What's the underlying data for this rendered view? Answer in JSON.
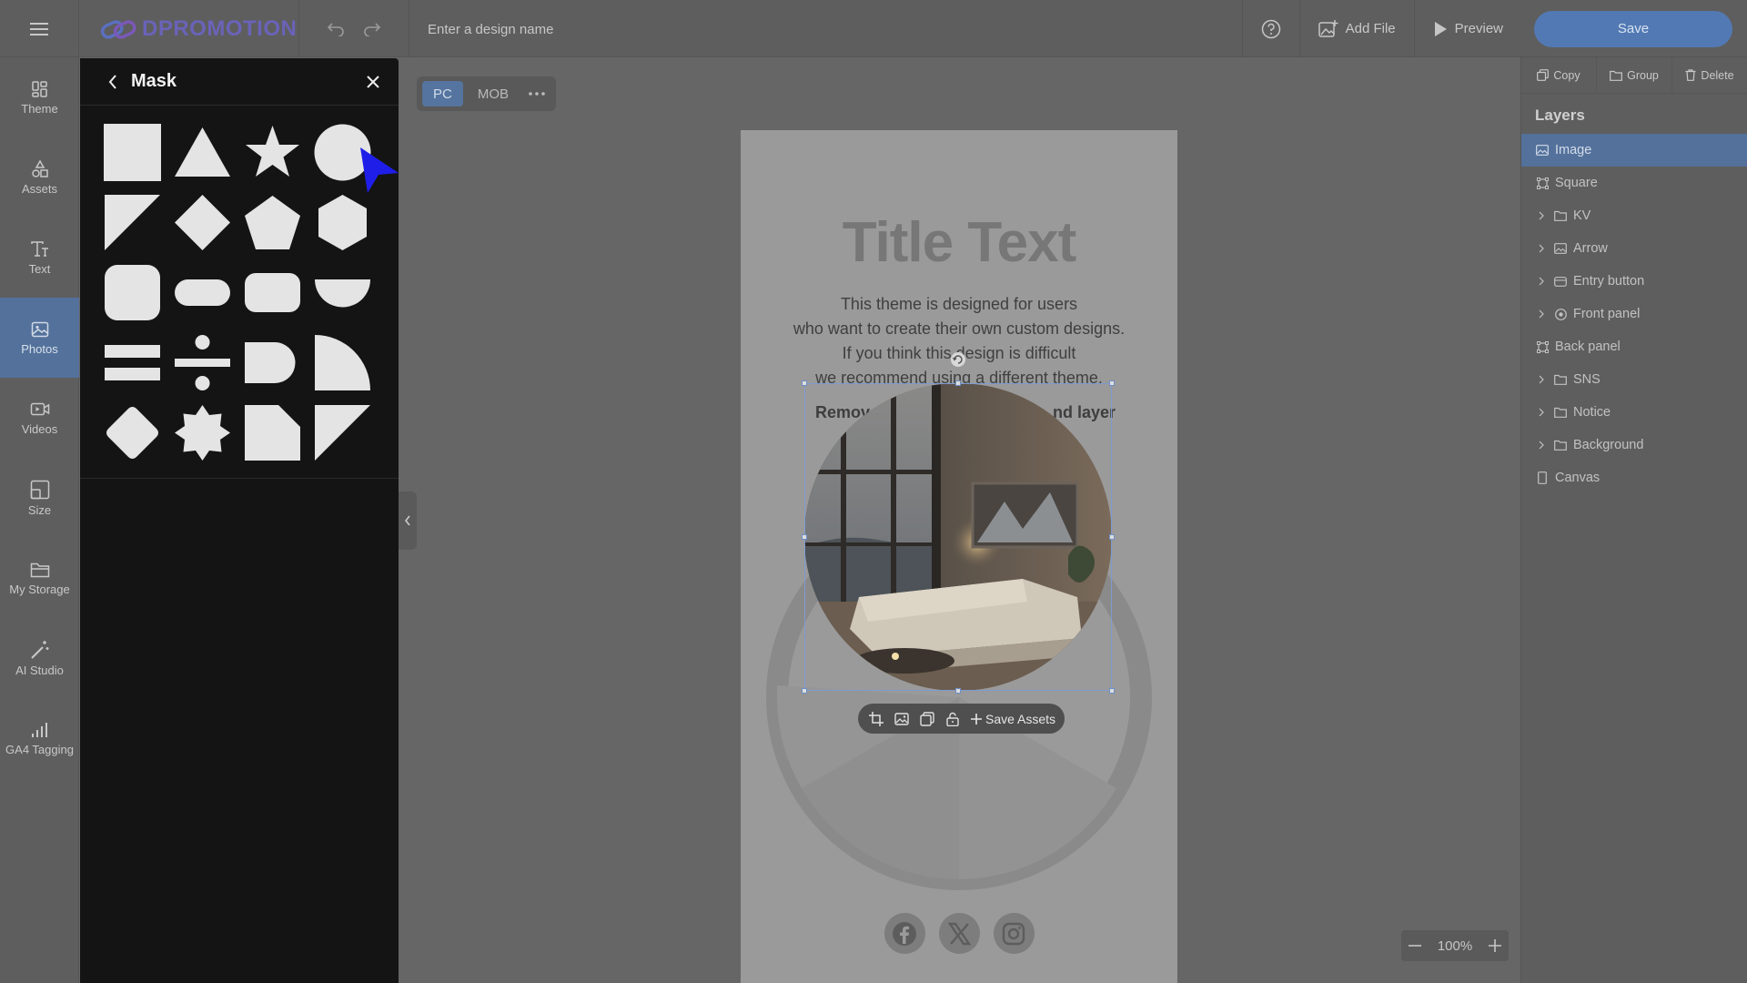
{
  "topbar": {
    "logo_text": "DPROMOTION",
    "design_name_placeholder": "Enter a design name",
    "add_file_label": "Add File",
    "preview_label": "Preview",
    "save_label": "Save"
  },
  "leftnav": {
    "items": [
      {
        "label": "Theme",
        "icon": "theme-icon"
      },
      {
        "label": "Assets",
        "icon": "assets-icon"
      },
      {
        "label": "Text",
        "icon": "text-icon"
      },
      {
        "label": "Photos",
        "icon": "photos-icon",
        "active": true
      },
      {
        "label": "Videos",
        "icon": "videos-icon"
      },
      {
        "label": "Size",
        "icon": "size-icon"
      },
      {
        "label": "My Storage",
        "icon": "folder-icon"
      },
      {
        "label": "AI Studio",
        "icon": "magic-wand-icon"
      },
      {
        "label": "GA4 Tagging",
        "icon": "bar-chart-icon"
      }
    ]
  },
  "mask_panel": {
    "title": "Mask",
    "shapes": [
      "square",
      "triangle",
      "star",
      "circle",
      "corner-triangle",
      "diamond",
      "pentagon",
      "hexagon",
      "rounded-square",
      "pill",
      "rounded-rectangle",
      "half-circle",
      "double-bar",
      "divide",
      "d-shape",
      "quarter-circle",
      "rounded-diamond",
      "eight-point-star",
      "cut-corner",
      "corner-triangle-right"
    ]
  },
  "device_toggle": {
    "pc_label": "PC",
    "mob_label": "MOB",
    "active": "PC"
  },
  "canvas": {
    "title": "Title Text",
    "body_lines": [
      "This theme is designed for users",
      "who want to create their own custom designs.",
      "If you think this design is difficult",
      "we recommend using a different theme."
    ],
    "remove_left": "Remov",
    "remove_right": "nd layer"
  },
  "image_toolbar": {
    "save_assets_label": "Save Assets"
  },
  "zoom": {
    "level": "100%"
  },
  "rightpanel": {
    "copy_label": "Copy",
    "group_label": "Group",
    "delete_label": "Delete",
    "layers_title": "Layers",
    "layers": [
      {
        "name": "Image",
        "icon": "image-icon",
        "active": true,
        "expandable": false
      },
      {
        "name": "Square",
        "icon": "frame-icon",
        "expandable": false
      },
      {
        "name": "KV",
        "icon": "folder-icon",
        "expandable": true
      },
      {
        "name": "Arrow",
        "icon": "image-icon",
        "expandable": true
      },
      {
        "name": "Entry button",
        "icon": "button-icon",
        "expandable": true
      },
      {
        "name": "Front panel",
        "icon": "group-icon",
        "expandable": true
      },
      {
        "name": "Back panel",
        "icon": "frame-icon",
        "expandable": false
      },
      {
        "name": "SNS",
        "icon": "folder-icon",
        "expandable": true
      },
      {
        "name": "Notice",
        "icon": "folder-icon",
        "expandable": true
      },
      {
        "name": "Background",
        "icon": "folder-icon",
        "expandable": true
      },
      {
        "name": "Canvas",
        "icon": "canvas-icon",
        "expandable": false
      }
    ]
  },
  "colors": {
    "accent": "#5279b3",
    "active_nav": "#53719b",
    "panel_bg": "#141414",
    "cursor": "#1f1ee8"
  }
}
